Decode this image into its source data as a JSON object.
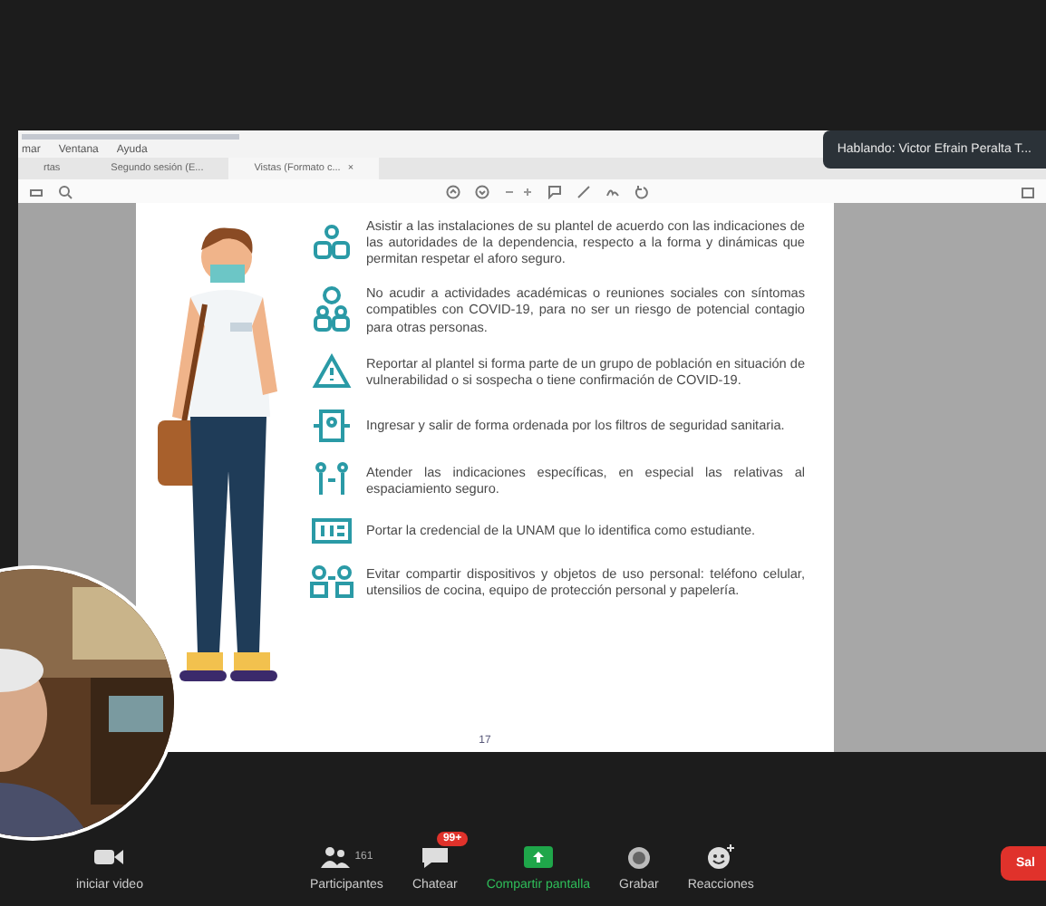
{
  "viewer": {
    "menu": [
      "mar",
      "Ventana",
      "Ayuda"
    ],
    "tabs": [
      {
        "label": "rtas",
        "selected": false
      },
      {
        "label": "Segundo sesión (E...",
        "selected": false
      },
      {
        "label": "Vistas (Formato c...",
        "selected": true
      }
    ],
    "tab_close": "×",
    "page_number": "17"
  },
  "instructions": [
    {
      "kind": "people",
      "text": "Asistir a las instalaciones de su plantel de acuerdo con las indicaciones de las autoridades de la dependencia, respecto a la forma y dinámicas que permitan respetar el aforo seguro."
    },
    {
      "kind": "group",
      "text": "No acudir a actividades académicas o reuniones sociales con síntomas compatibles con COVID-19, para no ser un riesgo de potencial contagio para otras personas."
    },
    {
      "kind": "warning",
      "text": "Reportar al plantel si forma parte de un grupo de población en situación de vulnerabilidad o si sospecha o tiene confirmación de COVID-19."
    },
    {
      "kind": "door",
      "text": "Ingresar y salir de forma ordenada por los filtros de seguridad sanitaria."
    },
    {
      "kind": "distance",
      "text": "Atender las indicaciones específicas, en especial las relativas al espaciamiento seguro."
    },
    {
      "kind": "card",
      "text": "Portar la credencial de la UNAM que lo identifica como estudiante."
    },
    {
      "kind": "devices",
      "text": "Evitar compartir dispositivos y objetos de uso personal: teléfono celular, utensilios de cocina, equipo de protección personal y papelería."
    }
  ],
  "speaker_notice": "Hablando: Victor Efrain Peralta T...",
  "toolbar": [
    {
      "kind": "video",
      "label": "iniciar video"
    },
    {
      "kind": "participants",
      "label": "Participantes",
      "count": "161"
    },
    {
      "kind": "chat",
      "label": "Chatear",
      "badge": "99+"
    },
    {
      "kind": "share",
      "label": "Compartir pantalla"
    },
    {
      "kind": "record",
      "label": "Grabar"
    },
    {
      "kind": "reactions",
      "label": "Reacciones"
    }
  ],
  "leave_button": "Sal"
}
